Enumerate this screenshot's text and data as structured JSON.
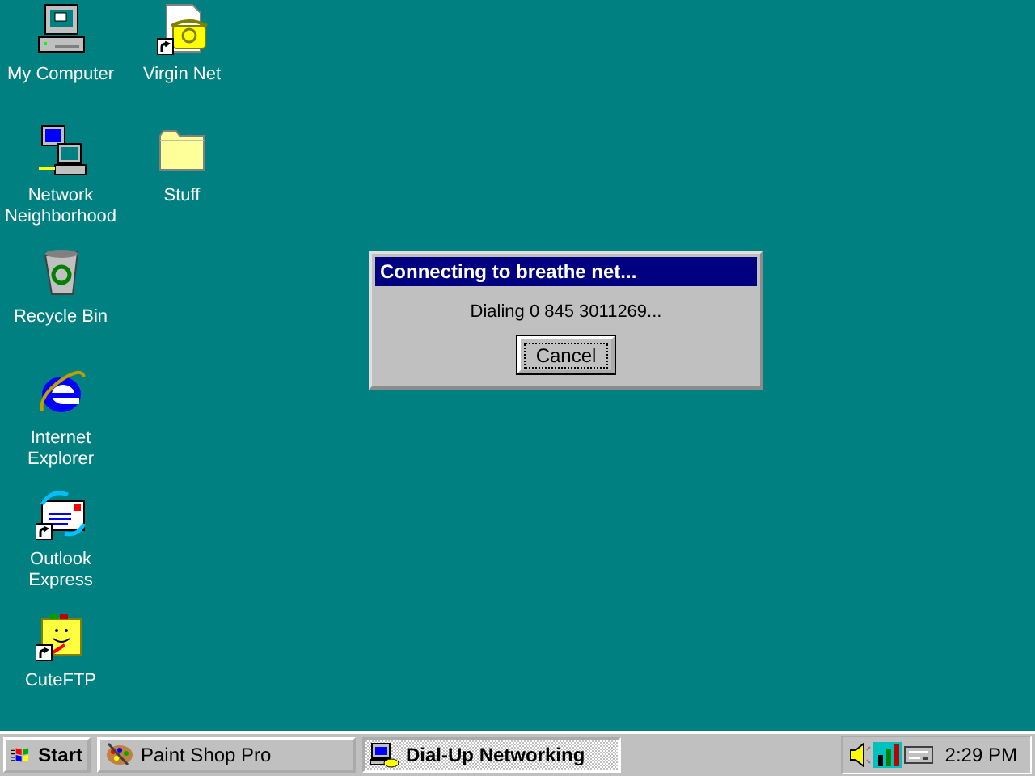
{
  "desktop_icons": [
    {
      "label": "My Computer",
      "kind": "computer",
      "shortcut": false
    },
    {
      "label": "Virgin Net",
      "kind": "phone",
      "shortcut": true
    },
    {
      "label": "Network Neighborhood",
      "kind": "network",
      "shortcut": false
    },
    {
      "label": "Stuff",
      "kind": "folder",
      "shortcut": false
    },
    {
      "label": "Recycle Bin",
      "kind": "recycle",
      "shortcut": false
    },
    {
      "label": "Internet Explorer",
      "kind": "browser",
      "shortcut": false
    },
    {
      "label": "Outlook Express",
      "kind": "mail",
      "shortcut": true
    },
    {
      "label": "CuteFTP",
      "kind": "smiley-folder",
      "shortcut": true
    }
  ],
  "dialog": {
    "title": "Connecting to breathe net...",
    "message": "Dialing 0 845 3011269...",
    "buttons": [
      {
        "label": "Cancel",
        "focused": true
      }
    ]
  },
  "taskbar": {
    "start": "Start",
    "tasks": [
      {
        "label": "Paint Shop Pro",
        "kind": "palette",
        "selected": false
      },
      {
        "label": "Dial-Up Networking",
        "kind": "dialup",
        "selected": true
      }
    ],
    "clock": "2:29 PM"
  }
}
